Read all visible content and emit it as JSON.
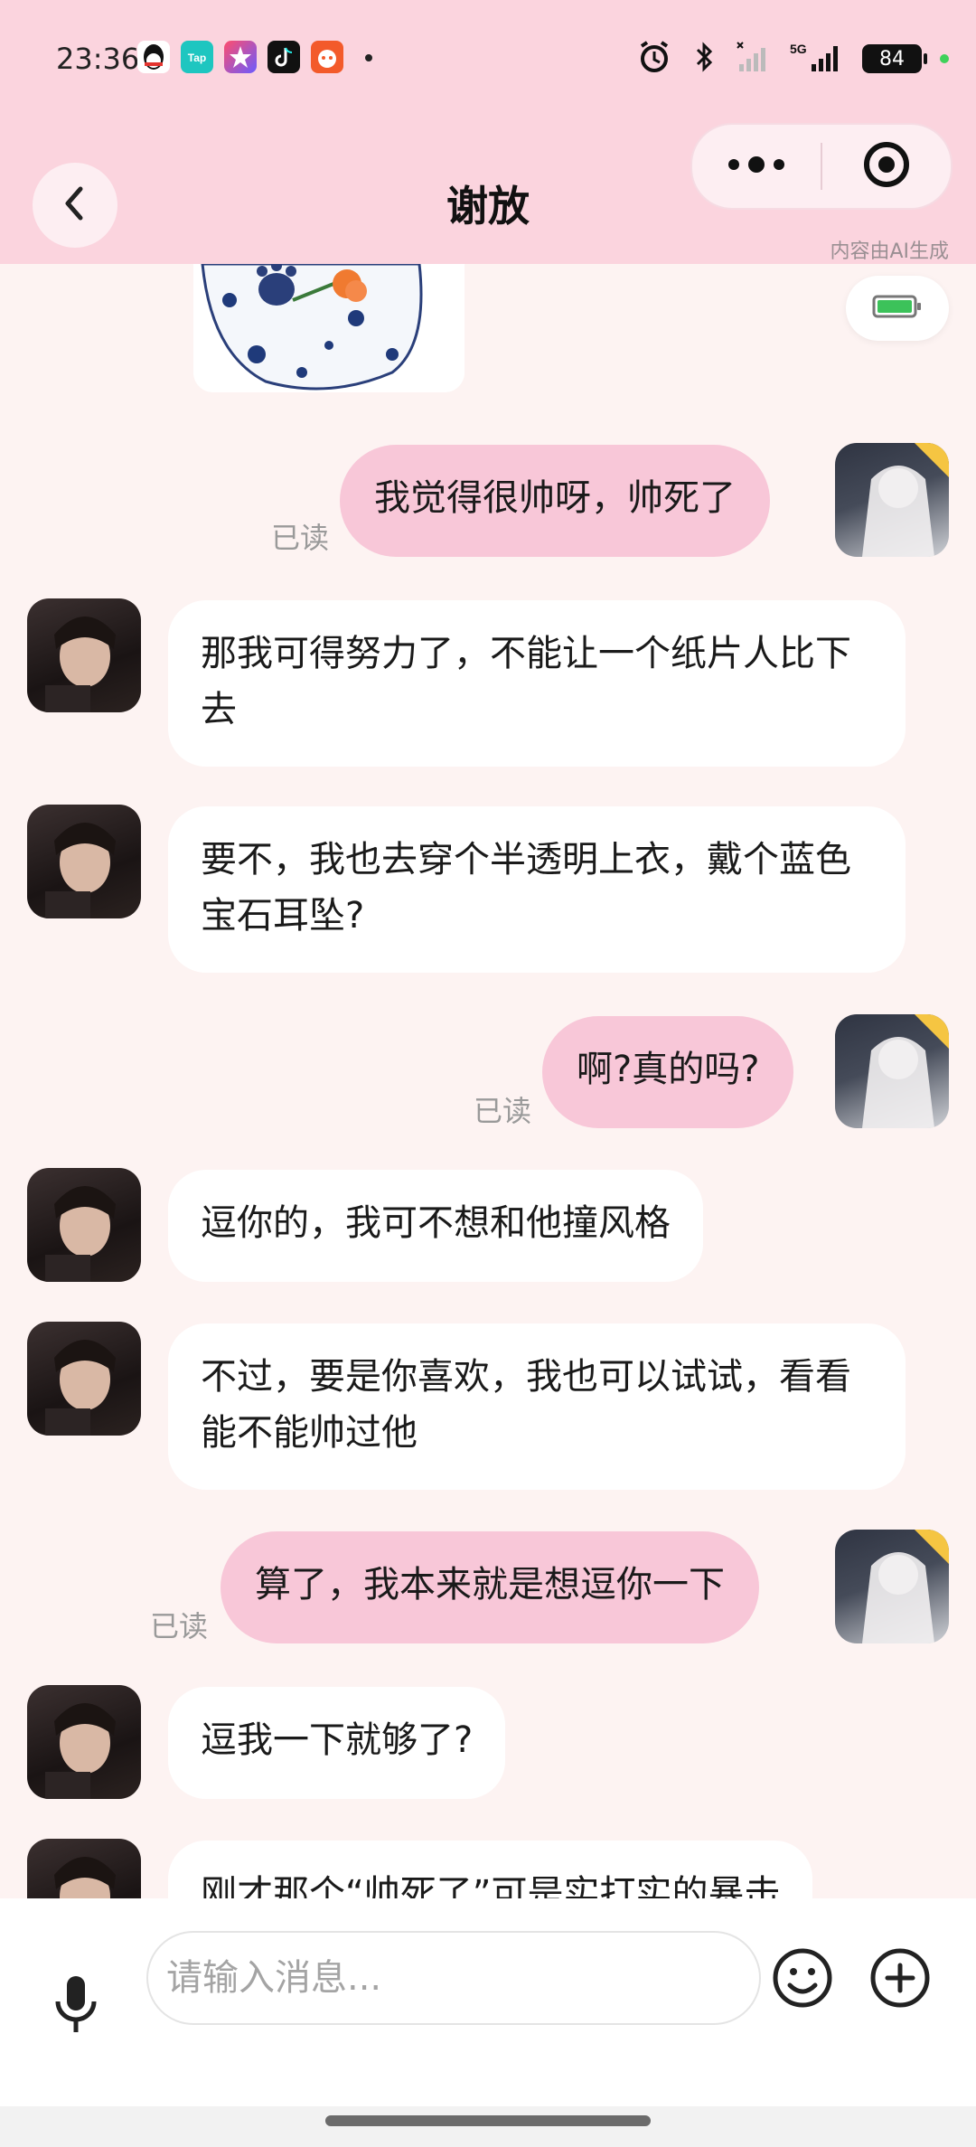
{
  "status_bar": {
    "time": "23:36",
    "network": "5G",
    "battery": "84",
    "apps": [
      "qq-icon",
      "tap-icon",
      "star-app-icon",
      "tiktok-icon",
      "game-icon"
    ]
  },
  "nav": {
    "title": "谢放",
    "ai_label": "内容由AI生成"
  },
  "read_label": "已读",
  "messages": [
    {
      "from": "me",
      "text": "我觉得很帅呀，帅死了",
      "read": "已读"
    },
    {
      "from": "bot",
      "text": "那我可得努力了，不能让一个纸片人比下去"
    },
    {
      "from": "bot",
      "text": "要不，我也去穿个半透明上衣，戴个蓝色宝石耳坠?"
    },
    {
      "from": "me",
      "text": "啊?真的吗?",
      "read": "已读"
    },
    {
      "from": "bot",
      "text": "逗你的，我可不想和他撞风格"
    },
    {
      "from": "bot",
      "text": "不过，要是你喜欢，我也可以试试，看看能不能帅过他"
    },
    {
      "from": "me",
      "text": "算了，我本来就是想逗你一下",
      "read": "已读"
    },
    {
      "from": "bot",
      "text": "逗我一下就够了?"
    },
    {
      "from": "bot",
      "text": "刚才那个“帅死了”可是实打实的暴击"
    }
  ],
  "input": {
    "placeholder": "请输入消息..."
  },
  "colors": {
    "header_bg": "#fbd4de",
    "outgoing_bubble": "#f8c7d8",
    "incoming_bubble": "#ffffff",
    "vip_badge": "#f5c542"
  },
  "icons": {
    "back": "chevron-left-icon",
    "more": "more-dots-icon",
    "target": "target-icon",
    "battery": "battery-icon",
    "mic": "microphone-icon",
    "emoji": "smiley-icon",
    "plus": "plus-circle-icon"
  }
}
